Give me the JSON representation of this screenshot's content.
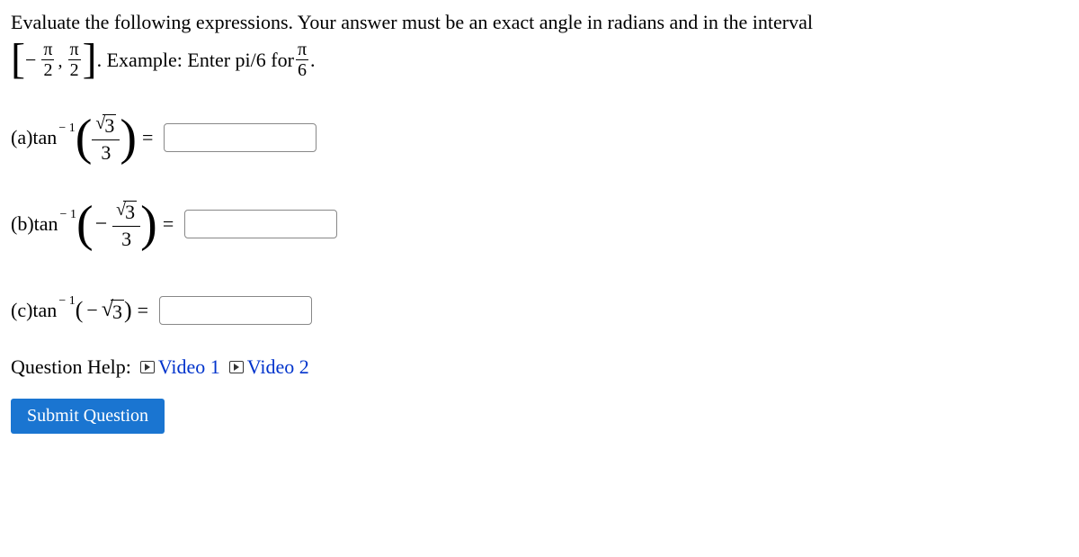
{
  "intro": {
    "text1": "Evaluate the following expressions. Your answer must be an exact angle in radians and in the interval",
    "interval_left_num": "π",
    "interval_left_den": "2",
    "interval_right_num": "π",
    "interval_right_den": "2",
    "text2": ". Example: Enter pi/6 for ",
    "ex_num": "π",
    "ex_den": "6",
    "text3": "."
  },
  "problems": {
    "a": {
      "label": "(a) ",
      "fn": "tan",
      "sup": "− 1",
      "sqrt_rad": "3",
      "den": "3"
    },
    "b": {
      "label": "(b) ",
      "fn": "tan",
      "sup": "− 1",
      "sqrt_rad": "3",
      "den": "3"
    },
    "c": {
      "label": "(c) ",
      "fn": "tan",
      "sup": "− 1",
      "sqrt_rad": "3"
    }
  },
  "help": {
    "label": "Question Help:",
    "video1": "Video 1",
    "video2": "Video 2"
  },
  "submit": "Submit Question",
  "equals": "="
}
